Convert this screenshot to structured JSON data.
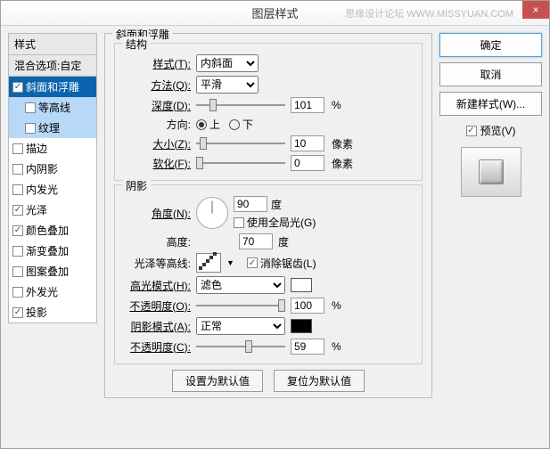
{
  "title": "图层样式",
  "watermark": "思缘设计论坛 WWW.MISSYUAN.COM",
  "close_icon": "×",
  "styles_panel": {
    "header": "样式",
    "blend_options": "混合选项:自定",
    "items": [
      {
        "label": "斜面和浮雕",
        "checked": true,
        "selected": true
      },
      {
        "label": "等高线",
        "checked": false,
        "indent": true,
        "highlight": true
      },
      {
        "label": "纹理",
        "checked": false,
        "indent": true,
        "highlight": true
      },
      {
        "label": "描边",
        "checked": false
      },
      {
        "label": "内阴影",
        "checked": false
      },
      {
        "label": "内发光",
        "checked": false
      },
      {
        "label": "光泽",
        "checked": true
      },
      {
        "label": "颜色叠加",
        "checked": true
      },
      {
        "label": "渐变叠加",
        "checked": false
      },
      {
        "label": "图案叠加",
        "checked": false
      },
      {
        "label": "外发光",
        "checked": false
      },
      {
        "label": "投影",
        "checked": true
      }
    ]
  },
  "bevel": {
    "title": "斜面和浮雕",
    "structure": {
      "title": "结构",
      "style_label": "样式(T):",
      "style_value": "内斜面",
      "method_label": "方法(Q):",
      "method_value": "平滑",
      "depth_label": "深度(D):",
      "depth_value": "101",
      "depth_unit": "%",
      "direction_label": "方向:",
      "up": "上",
      "down": "下",
      "size_label": "大小(Z):",
      "size_value": "10",
      "size_unit": "像素",
      "soften_label": "软化(F):",
      "soften_value": "0",
      "soften_unit": "像素"
    },
    "shading": {
      "title": "阴影",
      "angle_label": "角度(N):",
      "angle_value": "90",
      "angle_unit": "度",
      "global_light": "使用全局光(G)",
      "global_checked": false,
      "altitude_label": "高度:",
      "altitude_value": "70",
      "altitude_unit": "度",
      "gloss_label": "光泽等高线:",
      "antialias": "消除锯齿(L)",
      "antialias_checked": true,
      "highlight_mode_label": "高光模式(H):",
      "highlight_mode_value": "滤色",
      "highlight_opacity_label": "不透明度(O):",
      "highlight_opacity_value": "100",
      "opacity_unit": "%",
      "shadow_mode_label": "阴影模式(A):",
      "shadow_mode_value": "正常",
      "shadow_opacity_label": "不透明度(C):",
      "shadow_opacity_value": "59"
    },
    "buttons": {
      "default": "设置为默认值",
      "reset": "复位为默认值"
    }
  },
  "right": {
    "ok": "确定",
    "cancel": "取消",
    "new_style": "新建样式(W)...",
    "preview": "预览(V)",
    "preview_checked": true
  }
}
